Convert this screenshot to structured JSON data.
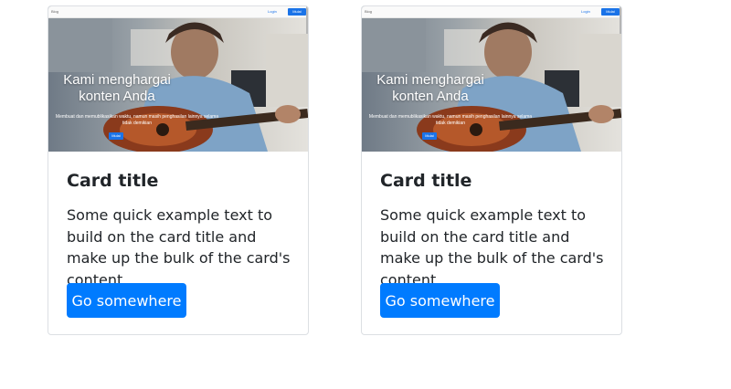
{
  "cards": [
    {
      "thumbnail": {
        "nav_logo": "Blog",
        "nav_login": "Login",
        "nav_button": "Mulai",
        "hero_title": "Kami menghargai konten Anda",
        "hero_subtitle": "Membuat dan memublikasikan waktu, namun masih penghasilan lainnya selama tidak demikian",
        "hero_button": "Mulai"
      },
      "title": "Card title",
      "text": "Some quick example text to build on the card title and make up the bulk of the card's content.",
      "button_label": "Go somewhere"
    },
    {
      "thumbnail": {
        "nav_logo": "Blog",
        "nav_login": "Login",
        "nav_button": "Mulai",
        "hero_title": "Kami menghargai konten Anda",
        "hero_subtitle": "Membuat dan memublikasikan waktu, namun masih penghasilan lainnya selama tidak demikian",
        "hero_button": "Mulai"
      },
      "title": "Card title",
      "text": "Some quick example text to build on the card title and make up the bulk of the card's content.",
      "button_label": "Go somewhere"
    }
  ],
  "colors": {
    "primary": "#007bff",
    "text": "#212529",
    "border": "#dcdfe3"
  }
}
